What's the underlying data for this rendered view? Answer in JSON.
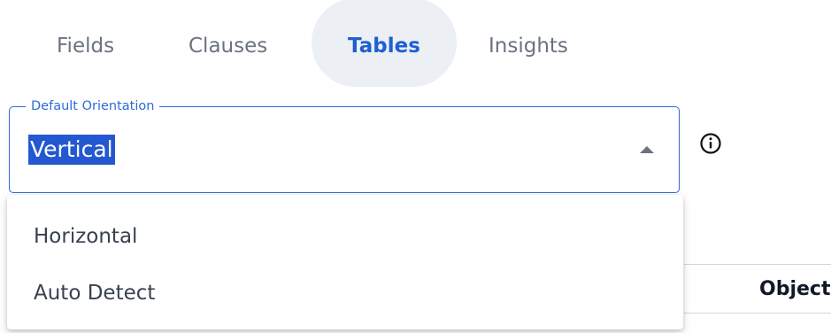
{
  "tabs": {
    "items": [
      {
        "label": "Fields"
      },
      {
        "label": "Clauses"
      },
      {
        "label": "Tables"
      },
      {
        "label": "Insights"
      }
    ],
    "active": "Tables"
  },
  "orientation_select": {
    "label": "Default Orientation",
    "value": "Vertical",
    "expanded": true,
    "options": [
      {
        "label": "Horizontal"
      },
      {
        "label": "Auto Detect"
      }
    ],
    "icon": "triangle-up-icon"
  },
  "info": {
    "icon": "info-circle-icon"
  },
  "table": {
    "columns": [
      {
        "label": "Object"
      }
    ]
  },
  "colors": {
    "accent": "#2f6bd8",
    "active_tab_bg": "#eceff4",
    "selection_bg": "#2458d0"
  }
}
